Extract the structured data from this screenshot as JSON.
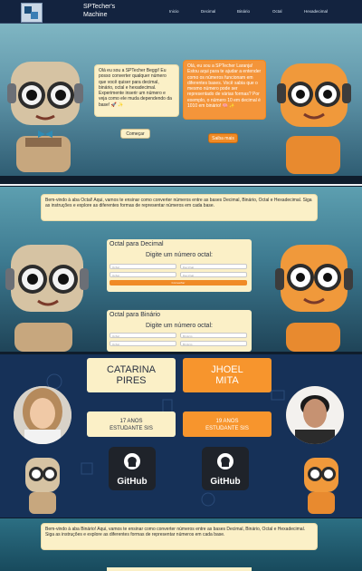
{
  "nav": {
    "brand_line1": "SPTecher's",
    "brand_line2": "Machine",
    "links": [
      "Inicio",
      "Decimal",
      "Binário",
      "Octal",
      "Hexadecimal"
    ]
  },
  "hero": {
    "bubble_left": "Olá eu sou a SPTecher Beggi! Eu posso converter qualquer número que você quiser para decimal, binário, octal e hexadecimal. Experimente inserir um número e veja como ele muda dependendo da base! 🚀 ✨",
    "bubble_right": "Olá, eu sou a SPTecher Laranja! Estou aqui para te ajudar a entender como os números funcionam em diferentes bases. Você sabia que o mesmo número pode ser representado de várias formas? Por exemplo, o número 10 em decimal é 1010 em binário! 🧠 ✨",
    "btn_start": "Começar",
    "btn_learn": "Saiba mais"
  },
  "octal": {
    "intro": "Bem-vindo à aba Octal! Aqui, vamos te ensinar como converter números entre as bases Decimal, Binário, Octal e Hexadecimal. Siga as instruções e explore as diferentes formas de representar números em cada base.",
    "card1_title": "Octal para Decimal",
    "card1_sub": "Digite um número octal:",
    "card2_title": "Octal para Binário",
    "card2_sub": "Digite um número octal:",
    "input_left_placeholder": "Octal",
    "input_right_placeholder": "Decimal",
    "input_right2_placeholder": "Binário",
    "convert_label": "Converter"
  },
  "team": {
    "member1_name_line1": "CATARINA",
    "member1_name_line2": "PIRES",
    "member1_info_line1": "17 ANOS",
    "member1_info_line2": "ESTUDANTE SIS",
    "member2_name_line1": "JHOEL",
    "member2_name_line2": "MITA",
    "member2_info_line1": "19 ANOS",
    "member2_info_line2": "ESTUDANTE SIS",
    "github_label": "GitHub"
  },
  "binario": {
    "intro": "Bem-vindo à aba Binário! Aqui, vamos te ensinar como converter números entre as bases Decimal, Binário, Octal e Hexadecimal. Siga as instruções e explore as diferentes formas de representar números em cada base."
  },
  "colors": {
    "navy": "#13233f",
    "cream": "#fbf0c7",
    "orange": "#f08a25"
  }
}
